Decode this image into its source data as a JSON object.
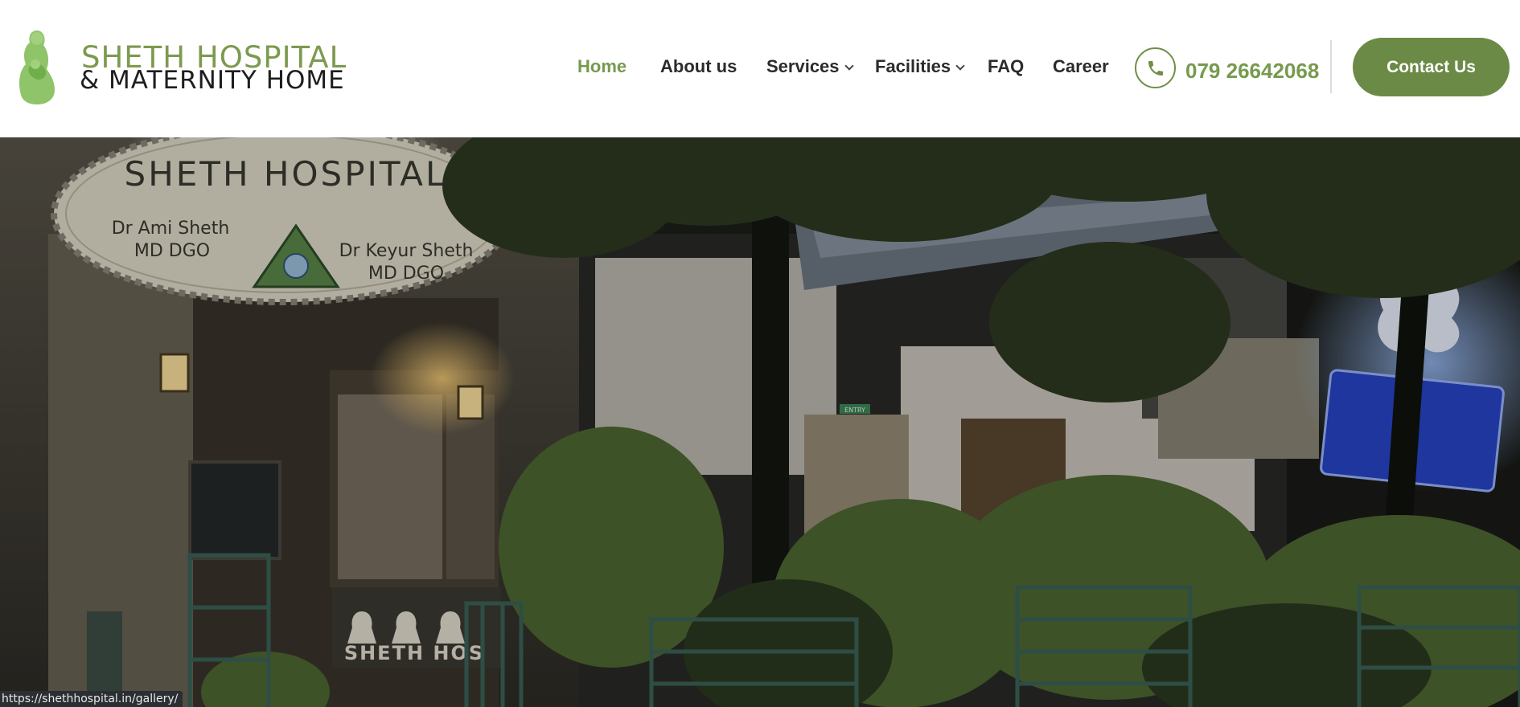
{
  "brand": {
    "name_line1": "SHETH HOSPITAL",
    "name_line2": "& MATERNITY HOME",
    "color": "#779a4e"
  },
  "nav": {
    "items": [
      {
        "label": "Home",
        "active": true,
        "dropdown": false
      },
      {
        "label": "About us",
        "active": false,
        "dropdown": false
      },
      {
        "label": "Services",
        "active": false,
        "dropdown": true
      },
      {
        "label": "Facilities",
        "active": false,
        "dropdown": true
      },
      {
        "label": "FAQ",
        "active": false,
        "dropdown": false
      },
      {
        "label": "Career",
        "active": false,
        "dropdown": false
      }
    ]
  },
  "contact": {
    "phone_icon": "phone-icon",
    "phone": "079 26642068",
    "button_label": "Contact Us",
    "accent": "#6b8a46"
  },
  "hero": {
    "sign_title": "SHETH HOSPITAL",
    "doctor1_name": "Dr Ami Sheth",
    "doctor1_degree": "MD DGO",
    "doctor2_name": "Dr Keyur Sheth",
    "doctor2_degree": "MD DGO",
    "entry_sign": "ENTRY",
    "lower_sign": "SHETH HOS"
  },
  "status_bar": {
    "url": "https://shethhospital.in/gallery/"
  }
}
